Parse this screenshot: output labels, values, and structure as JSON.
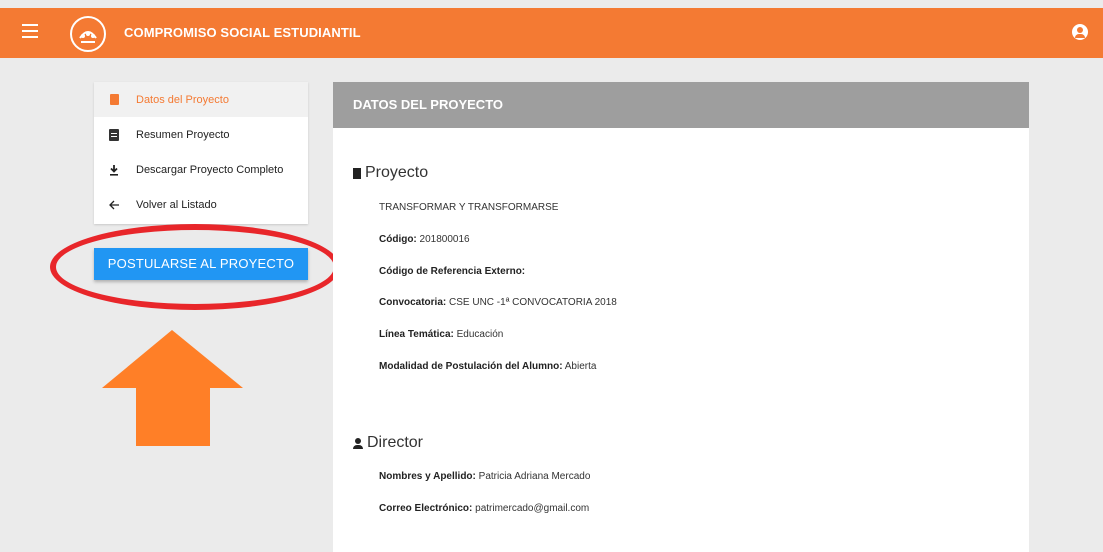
{
  "header": {
    "title": "COMPROMISO SOCIAL ESTUDIANTIL",
    "menu_icon": "hamburger-icon",
    "user_icon": "account-circle-icon",
    "accent": "#f47a33"
  },
  "sidebar": {
    "items": [
      {
        "label": "Datos del Proyecto",
        "icon": "bookmark-icon"
      },
      {
        "label": "Resumen Proyecto",
        "icon": "clipboard-icon"
      },
      {
        "label": "Descargar Proyecto Completo",
        "icon": "download-icon"
      },
      {
        "label": "Volver al Listado",
        "icon": "arrow-left-icon"
      }
    ],
    "apply_button": "POSTULARSE AL PROYECTO"
  },
  "panel": {
    "header": "DATOS DEL PROYECTO",
    "proyecto": {
      "title": "Proyecto",
      "name": "TRANSFORMAR Y TRANSFORMARSE",
      "codigo_label": "Código:",
      "codigo_value": " 201800016",
      "ref_label": "Código de Referencia Externo:",
      "convocatoria_label": "Convocatoria:",
      "convocatoria_value": " CSE UNC -1ª CONVOCATORIA 2018",
      "linea_label": "Línea Temática:",
      "linea_value": " Educación",
      "modalidad_label": "Modalidad de Postulación del Alumno:",
      "modalidad_value": " Abierta"
    },
    "director": {
      "title": "Director",
      "nombre_label": "Nombres y Apellido:",
      "nombre_value": " Patricia Adriana Mercado",
      "correo_label": "Correo Electrónico:",
      "correo_value": " patrimercado@gmail.com"
    }
  }
}
